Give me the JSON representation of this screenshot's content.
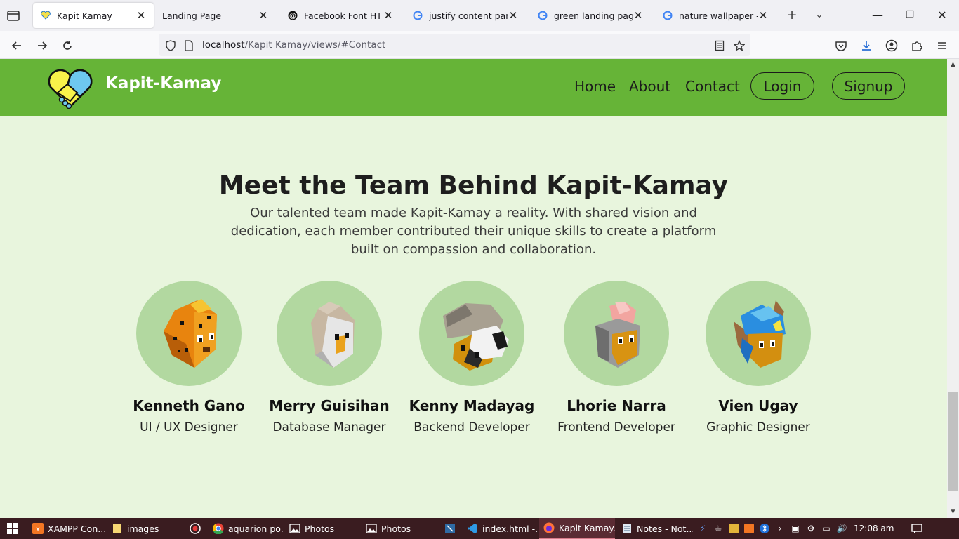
{
  "browser": {
    "tabs": [
      {
        "title": "Kapit Kamay",
        "active": true
      },
      {
        "title": "Landing Page",
        "active": false
      },
      {
        "title": "Facebook Font HTML",
        "active": false
      },
      {
        "title": "justify content paragra",
        "active": false
      },
      {
        "title": "green landing page - G",
        "active": false
      },
      {
        "title": "nature wallpaper - Goo",
        "active": false
      }
    ],
    "url_host": "localhost",
    "url_path": "/Kapit Kamay/views/#Contact"
  },
  "site": {
    "brand": "Kapit-Kamay",
    "nav": {
      "home": "Home",
      "about": "About",
      "contact": "Contact",
      "login": "Login",
      "signup": "Signup"
    },
    "colors": {
      "header": "#66b437",
      "background": "#e8f5dd",
      "avatar_bg": "#b2d8a0"
    }
  },
  "team": {
    "title": "Meet the Team Behind Kapit-Kamay",
    "subtitle": "Our talented team made Kapit-Kamay a reality. With shared vision and dedication, each member contributed their unique skills to create a platform built on compassion and collaboration.",
    "members": [
      {
        "name": "Kenneth Gano",
        "role": "UI / UX Designer",
        "avatar": "cheetah-avatar"
      },
      {
        "name": "Merry Guisihan",
        "role": "Database Manager",
        "avatar": "bird-avatar"
      },
      {
        "name": "Kenny Madayag",
        "role": "Backend Developer",
        "avatar": "panda-avatar"
      },
      {
        "name": "Lhorie Narra",
        "role": "Frontend Developer",
        "avatar": "knight-avatar"
      },
      {
        "name": "Vien Ugay",
        "role": "Graphic Designer",
        "avatar": "blue-creature-avatar"
      }
    ]
  },
  "taskbar": {
    "items": [
      {
        "label": "XAMPP Con..."
      },
      {
        "label": "images"
      },
      {
        "label": ""
      },
      {
        "label": "aquarion po..."
      },
      {
        "label": "Photos"
      },
      {
        "label": "Photos"
      },
      {
        "label": ""
      },
      {
        "label": "index.html -..."
      },
      {
        "label": "Kapit Kamay..."
      },
      {
        "label": "Notes - Not..."
      }
    ],
    "clock": "12:08 am"
  }
}
